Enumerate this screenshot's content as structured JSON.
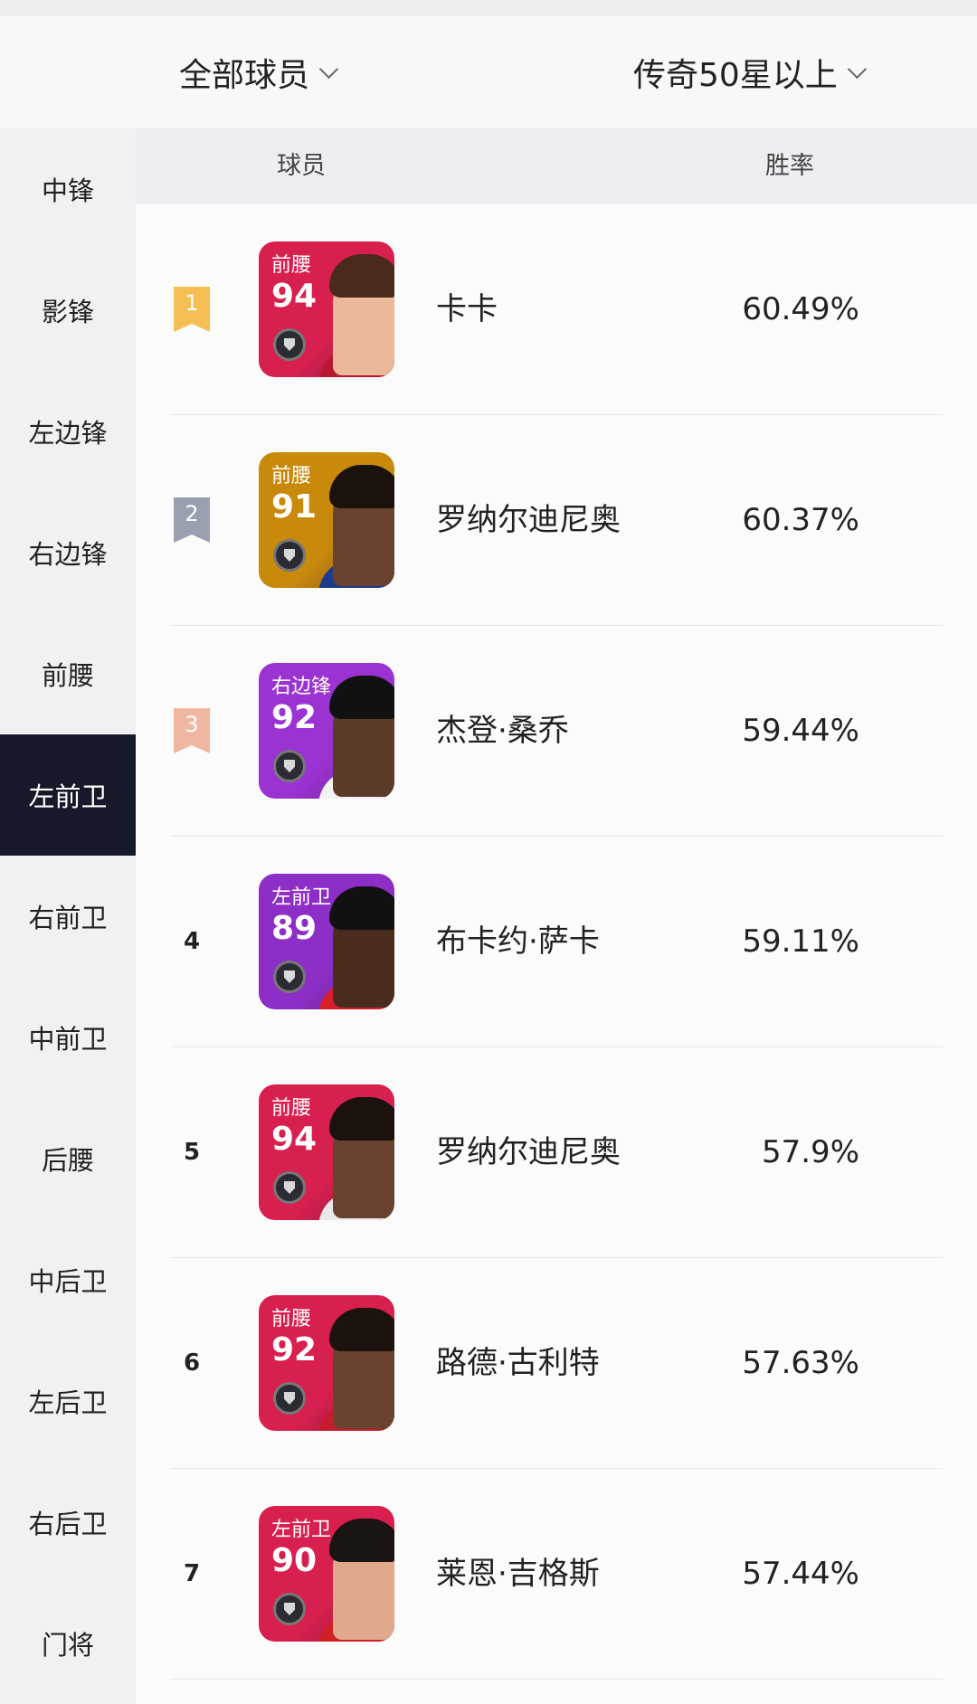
{
  "filters": {
    "player_scope": "全部球员",
    "card_filter": "传奇50星以上"
  },
  "sidebar": {
    "active_index": 5,
    "items": [
      {
        "label": "中锋"
      },
      {
        "label": "影锋"
      },
      {
        "label": "左边锋"
      },
      {
        "label": "右边锋"
      },
      {
        "label": "前腰"
      },
      {
        "label": "左前卫"
      },
      {
        "label": "右前卫"
      },
      {
        "label": "中前卫"
      },
      {
        "label": "后腰"
      },
      {
        "label": "中后卫"
      },
      {
        "label": "左后卫"
      },
      {
        "label": "右后卫"
      },
      {
        "label": "门将"
      }
    ]
  },
  "table": {
    "header_player": "球员",
    "header_rate": "胜率",
    "rows": [
      {
        "rank": "1",
        "position": "前腰",
        "rating": "94",
        "name": "卡卡",
        "rate": "60.49%",
        "medal_color": "#f6bf55",
        "card_color": "#d8204e",
        "skin": "#e9b99a",
        "hair": "#4a2a1c",
        "shirt": "#b8182f"
      },
      {
        "rank": "2",
        "position": "前腰",
        "rating": "91",
        "name": "罗纳尔迪尼奥",
        "rate": "60.37%",
        "medal_color": "#9aa0b0",
        "card_color": "#c98a0c",
        "skin": "#6a4330",
        "hair": "#1b120d",
        "shirt": "#1a3c8a"
      },
      {
        "rank": "3",
        "position": "右边锋",
        "rating": "92",
        "name": "杰登·桑乔",
        "rate": "59.44%",
        "medal_color": "#efb7a1",
        "card_color": "#9b33d3",
        "skin": "#5c3a28",
        "hair": "#111111",
        "shirt": "#f2f2f2"
      },
      {
        "rank": "4",
        "position": "左前卫",
        "rating": "89",
        "name": "布卡约·萨卡",
        "rate": "59.11%",
        "medal_color": "",
        "card_color": "#8d2fc7",
        "skin": "#4a2c1f",
        "hair": "#111111",
        "shirt": "#d8202c"
      },
      {
        "rank": "5",
        "position": "前腰",
        "rating": "94",
        "name": "罗纳尔迪尼奥",
        "rate": "57.9%",
        "medal_color": "",
        "card_color": "#d8204e",
        "skin": "#6a4330",
        "hair": "#1b120d",
        "shirt": "#e9e9e9"
      },
      {
        "rank": "6",
        "position": "前腰",
        "rating": "92",
        "name": "路德·古利特",
        "rate": "57.63%",
        "medal_color": "",
        "card_color": "#d8204e",
        "skin": "#6a4330",
        "hair": "#1d130e",
        "shirt": "#c51d2c"
      },
      {
        "rank": "7",
        "position": "左前卫",
        "rating": "90",
        "name": "莱恩·吉格斯",
        "rate": "57.44%",
        "medal_color": "",
        "card_color": "#d8204e",
        "skin": "#e0a98c",
        "hair": "#1a1412",
        "shirt": "#d11f26"
      }
    ]
  }
}
